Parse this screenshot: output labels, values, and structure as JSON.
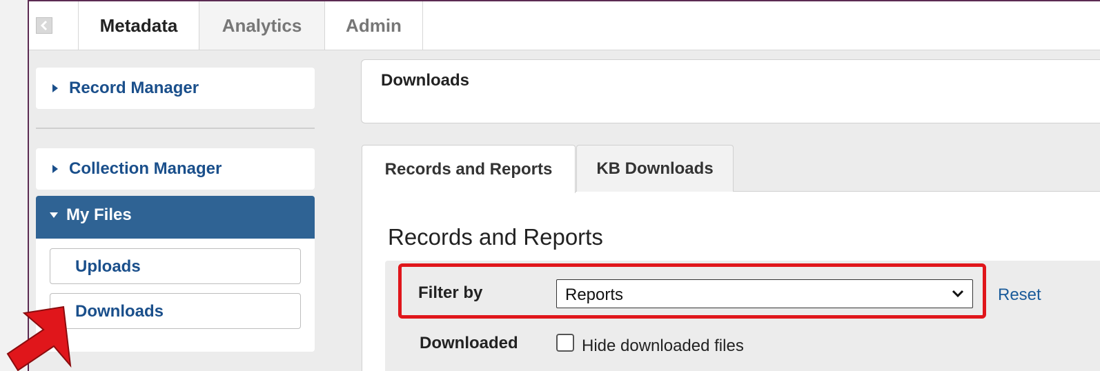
{
  "top_tabs": [
    {
      "label": "Metadata",
      "active": true
    },
    {
      "label": "Analytics",
      "active": false
    },
    {
      "label": "Admin",
      "active": false
    }
  ],
  "sidebar": {
    "record_manager": "Record Manager",
    "collection_manager": "Collection Manager",
    "my_files": {
      "label": "My Files",
      "items": [
        "Uploads",
        "Downloads"
      ]
    }
  },
  "main": {
    "page_title": "Downloads",
    "content_tabs": [
      {
        "label": "Records and Reports",
        "active": true
      },
      {
        "label": "KB Downloads",
        "active": false
      }
    ],
    "section_title": "Records and Reports",
    "filter": {
      "label": "Filter by",
      "selected": "Reports",
      "reset": "Reset"
    },
    "downloaded": {
      "label": "Downloaded",
      "checkbox_label": "Hide downloaded files",
      "checked": false
    }
  },
  "colors": {
    "accent": "#2f6394",
    "link": "#1a4f8b",
    "highlight": "#e0161b"
  }
}
